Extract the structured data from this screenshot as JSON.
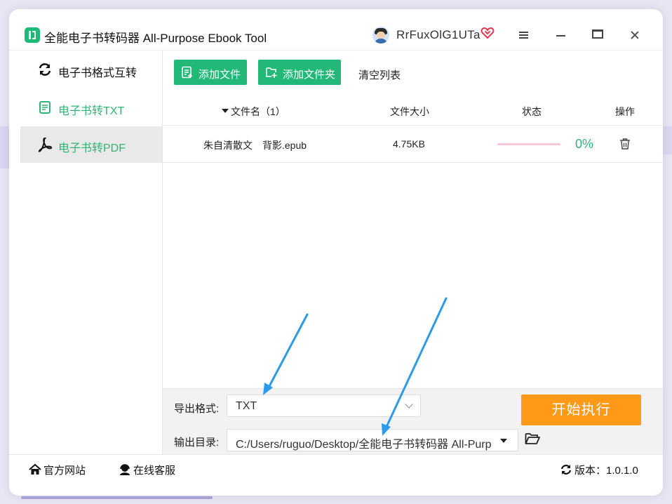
{
  "app": {
    "title": "全能电子书转码器 All-Purpose Ebook Tool",
    "username": "RrFuxOlG1UTa",
    "icons": {
      "logo": "app-logo-icon",
      "vip": "vip-heart-icon",
      "menu": "menu-icon",
      "minimize": "minimize-icon",
      "maximize": "maximize-icon",
      "close": "close-icon"
    }
  },
  "sidebar": {
    "items": [
      {
        "label": "电子书格式互转",
        "icon": "refresh-icon",
        "active": false
      },
      {
        "label": "电子书转TXT",
        "icon": "txt-file-icon",
        "active": false
      },
      {
        "label": "电子书转PDF",
        "icon": "pdf-icon",
        "active": true
      }
    ]
  },
  "toolbar": {
    "add_file_label": "添加文件",
    "add_folder_label": "添加文件夹",
    "clear_list_label": "清空列表",
    "accent_color": "#22b878"
  },
  "table": {
    "headers": {
      "name": "文件名（1）",
      "size": "文件大小",
      "status": "状态",
      "action": "操作"
    },
    "rows": [
      {
        "name": "朱自清散文　背影.epub",
        "size": "4.75KB",
        "progress": 0,
        "percent": "0%",
        "action_icon": "trash-icon"
      }
    ]
  },
  "settings": {
    "format_label": "导出格式:",
    "format_value": "TXT",
    "output_label": "输出目录:",
    "output_value": "C:/Users/ruguo/Desktop/全能电子书转码器 All-Purp",
    "folder_icon": "folder-open-icon",
    "start_label": "开始执行",
    "start_color": "#ff9a19"
  },
  "footer": {
    "website_label": "官方网站",
    "service_label": "在线客服",
    "version_label": "版本：1.0.1.0"
  }
}
